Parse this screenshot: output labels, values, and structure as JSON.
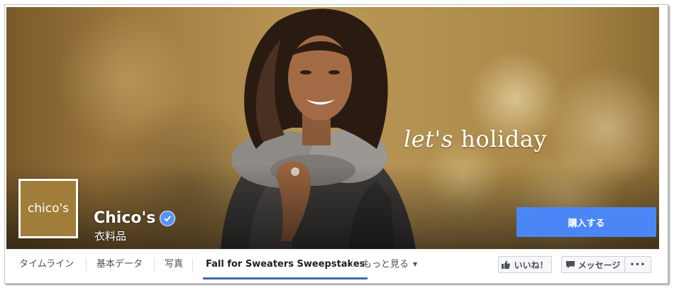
{
  "cover": {
    "tagline_italic": "let's",
    "tagline_rest": "holiday"
  },
  "profile": {
    "logo_text": "chico's",
    "name": "Chico's",
    "category": "衣料品"
  },
  "actions": {
    "buy_label": "購入する"
  },
  "nav": {
    "tabs": [
      {
        "label": "タイムライン"
      },
      {
        "label": "基本データ"
      },
      {
        "label": "写真"
      },
      {
        "label": "Fall for Sweaters Sweepstakes"
      },
      {
        "label": "もっと見る"
      }
    ],
    "like_label": "いいね！",
    "message_label": "メッセージ",
    "more_label": "•••"
  },
  "colors": {
    "accent": "#4b86f7",
    "verified": "#5890ff"
  }
}
